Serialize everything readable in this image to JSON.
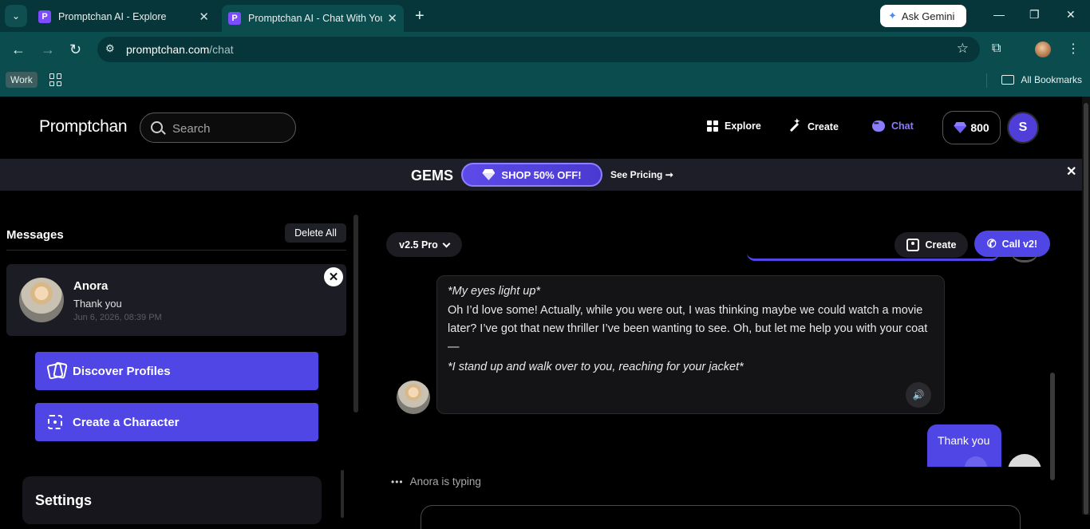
{
  "browser": {
    "tabs": [
      {
        "favicon": "P",
        "title": "Promptchan AI - Explore"
      },
      {
        "favicon": "P",
        "title": "Promptchan AI - Chat With Your"
      }
    ],
    "gemini_label": "Ask Gemini",
    "url_host": "promptchan.com",
    "url_path": "/chat",
    "bookmarks": {
      "work_label": "Work",
      "all_label": "All Bookmarks"
    }
  },
  "header": {
    "logo": "Promptchan",
    "search_placeholder": "Search",
    "nav": {
      "explore": "Explore",
      "create": "Create",
      "chat": "Chat"
    },
    "gems_count": "800",
    "user_initial": "S"
  },
  "banner": {
    "gems_label": "GEMS",
    "shop_label": "SHOP 50% OFF!",
    "pricing_label": "See Pricing ➞"
  },
  "sidebar": {
    "title": "Messages",
    "delete_all": "Delete All",
    "conversation": {
      "name": "Anora",
      "last_message": "Thank you",
      "date": "Jun 6, 2026, 08:39 PM"
    },
    "discover_label": "Discover Profiles",
    "create_char_label": "Create a Character",
    "settings_title": "Settings"
  },
  "chat": {
    "model_label": "v2.5 Pro",
    "create_label": "Create",
    "call_label": "Call v2!",
    "bot_message": {
      "line1": "*My eyes light up*",
      "line2": " Oh I’d love some! Actually, while you were out, I was thinking maybe we could watch a movie",
      "line3": "later? I’ve got that new thriller I’ve been wanting to see. Oh, but let me help you with your coat",
      "line4": "—",
      "line5": "*I stand up and walk over to you, reaching for your jacket*"
    },
    "user_message": "Thank you",
    "typing_text": "Anora is typing"
  }
}
